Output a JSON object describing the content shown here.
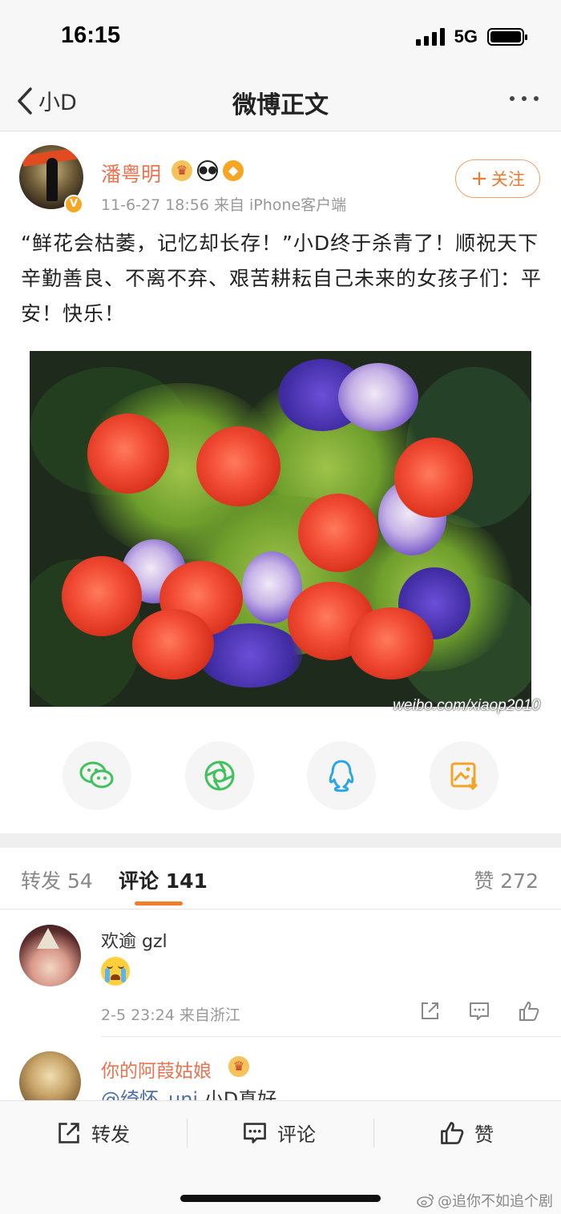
{
  "status_bar": {
    "time": "16:15",
    "network": "5G"
  },
  "nav": {
    "back_label": "小D",
    "title": "微博正文"
  },
  "post": {
    "username": "潘粤明",
    "meta": "11-6-27 18:56  来自 iPhone客户端",
    "follow_label": "关注",
    "text": "“鲜花会枯萎，记忆却长存！”小D终于杀青了！顺祝天下辛勤善良、不离不弃、艰苦耕耘自己未来的女孩子们：平安！快乐！",
    "image_watermark": "weibo.com/xiaop2010",
    "verified_mark": "V"
  },
  "share": {
    "items": [
      "wechat-icon",
      "moments-icon",
      "qq-icon",
      "save-image-icon"
    ]
  },
  "tabs": {
    "repost": "转发 54",
    "comments": "评论 141",
    "likes": "赞 272"
  },
  "comments": [
    {
      "name": "欢逾 gzl",
      "meta": "2-5 23:24  来自浙江"
    },
    {
      "name": "你的阿葭姑娘",
      "mention": "@绮怀_uni",
      "text": " 小D真好"
    }
  ],
  "bottom_bar": {
    "repost": "转发",
    "comment": "评论",
    "like": "赞"
  },
  "watermark": "@追你不如追个剧",
  "colors": {
    "accent": "#eb7350",
    "tab_indicator": "#f27c2b",
    "mention": "#4f6fa8"
  }
}
